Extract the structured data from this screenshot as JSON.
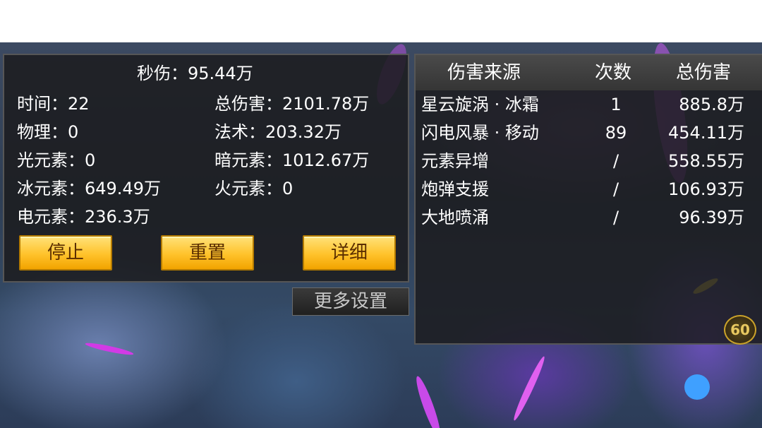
{
  "stats": {
    "dps": "秒伤：95.44万",
    "time": "时间：22",
    "total_damage": "总伤害：2101.78万",
    "physical": "物理：0",
    "magic": "法术：203.32万",
    "light": "光元素：0",
    "dark": "暗元素：1012.67万",
    "ice": "冰元素：649.49万",
    "fire": "火元素：0",
    "electric": "电元素：236.3万"
  },
  "buttons": {
    "stop": "停止",
    "reset": "重置",
    "details": "详细",
    "more_settings": "更多设置"
  },
  "damage_table": {
    "headers": [
      "伤害来源",
      "次数",
      "总伤害"
    ],
    "rows": [
      {
        "source": "星云旋涡 · 冰霜",
        "count": "1",
        "total": "885.8万"
      },
      {
        "source": "闪电风暴 · 移动",
        "count": "89",
        "total": "454.11万"
      },
      {
        "source": "元素异增",
        "count": "/",
        "total": "558.55万"
      },
      {
        "source": "炮弹支援",
        "count": "/",
        "total": "106.93万"
      },
      {
        "source": "大地喷涌",
        "count": "/",
        "total": "96.39万"
      }
    ]
  },
  "hud": {
    "level_badge": "60"
  },
  "colors": {
    "panel_bg": "#1c1c1e",
    "button_gold": "#ffc22a",
    "button_text": "#5a2e00",
    "text": "#ffffff"
  }
}
